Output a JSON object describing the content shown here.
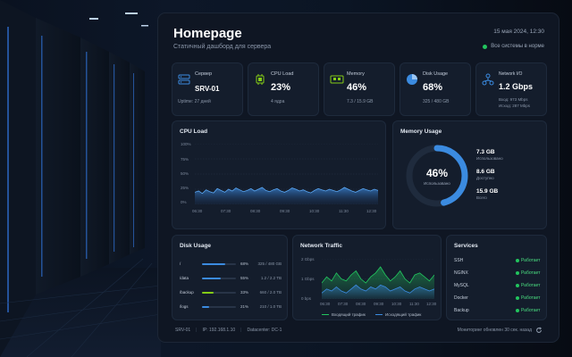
{
  "header": {
    "title": "Homepage",
    "subtitle": "Статичный дашборд для сервера",
    "date": "15 мая 2024, 12:30",
    "status": "Все системы в норме"
  },
  "stats": [
    {
      "label": "Сервер",
      "value": "SRV-01",
      "sub": "Uptime: 27 дней",
      "icon": "server-icon"
    },
    {
      "label": "CPU Load",
      "value": "23%",
      "sub": "4 ядра",
      "icon": "cpu-icon"
    },
    {
      "label": "Memory",
      "value": "46%",
      "sub": "7.3 / 15.9 GB",
      "icon": "memory-icon"
    },
    {
      "label": "Disk Usage",
      "value": "68%",
      "sub": "325 / 480 GB",
      "icon": "pie-icon"
    },
    {
      "label": "Network I/O",
      "value": "1.2 Gbps",
      "sub": "Вход: 973 Mbps",
      "sub2": "Исход: 287 Mbps",
      "icon": "network-icon"
    }
  ],
  "cpu_chart": {
    "title": "CPU Load",
    "y_ticks": [
      "100%",
      "75%",
      "50%",
      "25%",
      "0%"
    ],
    "x_ticks": [
      "06:30",
      "07:30",
      "08:30",
      "09:30",
      "10:30",
      "11:30",
      "12:30"
    ],
    "values": [
      20,
      22,
      18,
      24,
      21,
      19,
      26,
      23,
      20,
      25,
      22,
      27,
      24,
      21,
      23,
      26,
      22,
      25,
      28,
      23,
      21,
      24,
      26,
      22,
      20,
      23,
      27,
      25,
      22,
      24,
      21,
      19,
      23,
      26,
      24,
      22,
      25,
      23,
      21,
      24,
      28,
      25,
      22,
      20,
      23,
      26,
      24,
      22,
      25,
      23
    ]
  },
  "memory": {
    "title": "Memory Usage",
    "percent": 46,
    "percent_label": "46%",
    "center_label": "Использовано",
    "used": "7.3 GB",
    "used_label": "Использовано",
    "available": "8.6 GB",
    "available_label": "Доступно",
    "total": "15.9 GB",
    "total_label": "Всего",
    "accent": "#3b8be0"
  },
  "disk": {
    "title": "Disk Usage",
    "rows": [
      {
        "name": "/",
        "percent": 68,
        "pct_label": "68%",
        "size": "325 / 480 GB",
        "color": "#3b8be0"
      },
      {
        "name": "/data",
        "percent": 55,
        "pct_label": "55%",
        "size": "1.2 / 2.2 TB",
        "color": "#3b8be0"
      },
      {
        "name": "/backup",
        "percent": 33,
        "pct_label": "33%",
        "size": "660 / 2.0 TB",
        "color": "#84cc16"
      },
      {
        "name": "/logs",
        "percent": 21,
        "pct_label": "21%",
        "size": "210 / 1.0 TB",
        "color": "#3b8be0"
      }
    ]
  },
  "network": {
    "title": "Network Traffic",
    "y_ticks": [
      "2 Gbps",
      "1 Gbps",
      "0 bps"
    ],
    "x_ticks": [
      "06:30",
      "07:30",
      "08:30",
      "09:30",
      "10:30",
      "11:30",
      "12:30"
    ],
    "in_label": "Входящий трафик",
    "out_label": "Исходящий трафик",
    "in_values": [
      0.8,
      1.1,
      0.9,
      1.3,
      1.0,
      0.9,
      1.2,
      1.4,
      1.0,
      0.8,
      1.1,
      1.3,
      1.6,
      1.2,
      0.9,
      1.1,
      1.4,
      1.0,
      0.8,
      1.2,
      1.3,
      1.1,
      0.9,
      1.2
    ],
    "out_values": [
      0.3,
      0.5,
      0.4,
      0.6,
      0.4,
      0.3,
      0.5,
      0.7,
      0.5,
      0.4,
      0.6,
      0.5,
      0.7,
      0.6,
      0.4,
      0.5,
      0.6,
      0.4,
      0.3,
      0.5,
      0.6,
      0.5,
      0.4,
      0.5
    ]
  },
  "services": {
    "title": "Services",
    "rows": [
      {
        "name": "SSH",
        "status": "Работает"
      },
      {
        "name": "NGINX",
        "status": "Работает"
      },
      {
        "name": "MySQL",
        "status": "Работает"
      },
      {
        "name": "Docker",
        "status": "Работает"
      },
      {
        "name": "Backup",
        "status": "Работает"
      }
    ]
  },
  "footer": {
    "host": "SRV-01",
    "ip": "IP: 192.168.1.10",
    "datacenter": "Datacenter: DC-1",
    "updated": "Мониторинг обновлен 30 сек. назад"
  }
}
